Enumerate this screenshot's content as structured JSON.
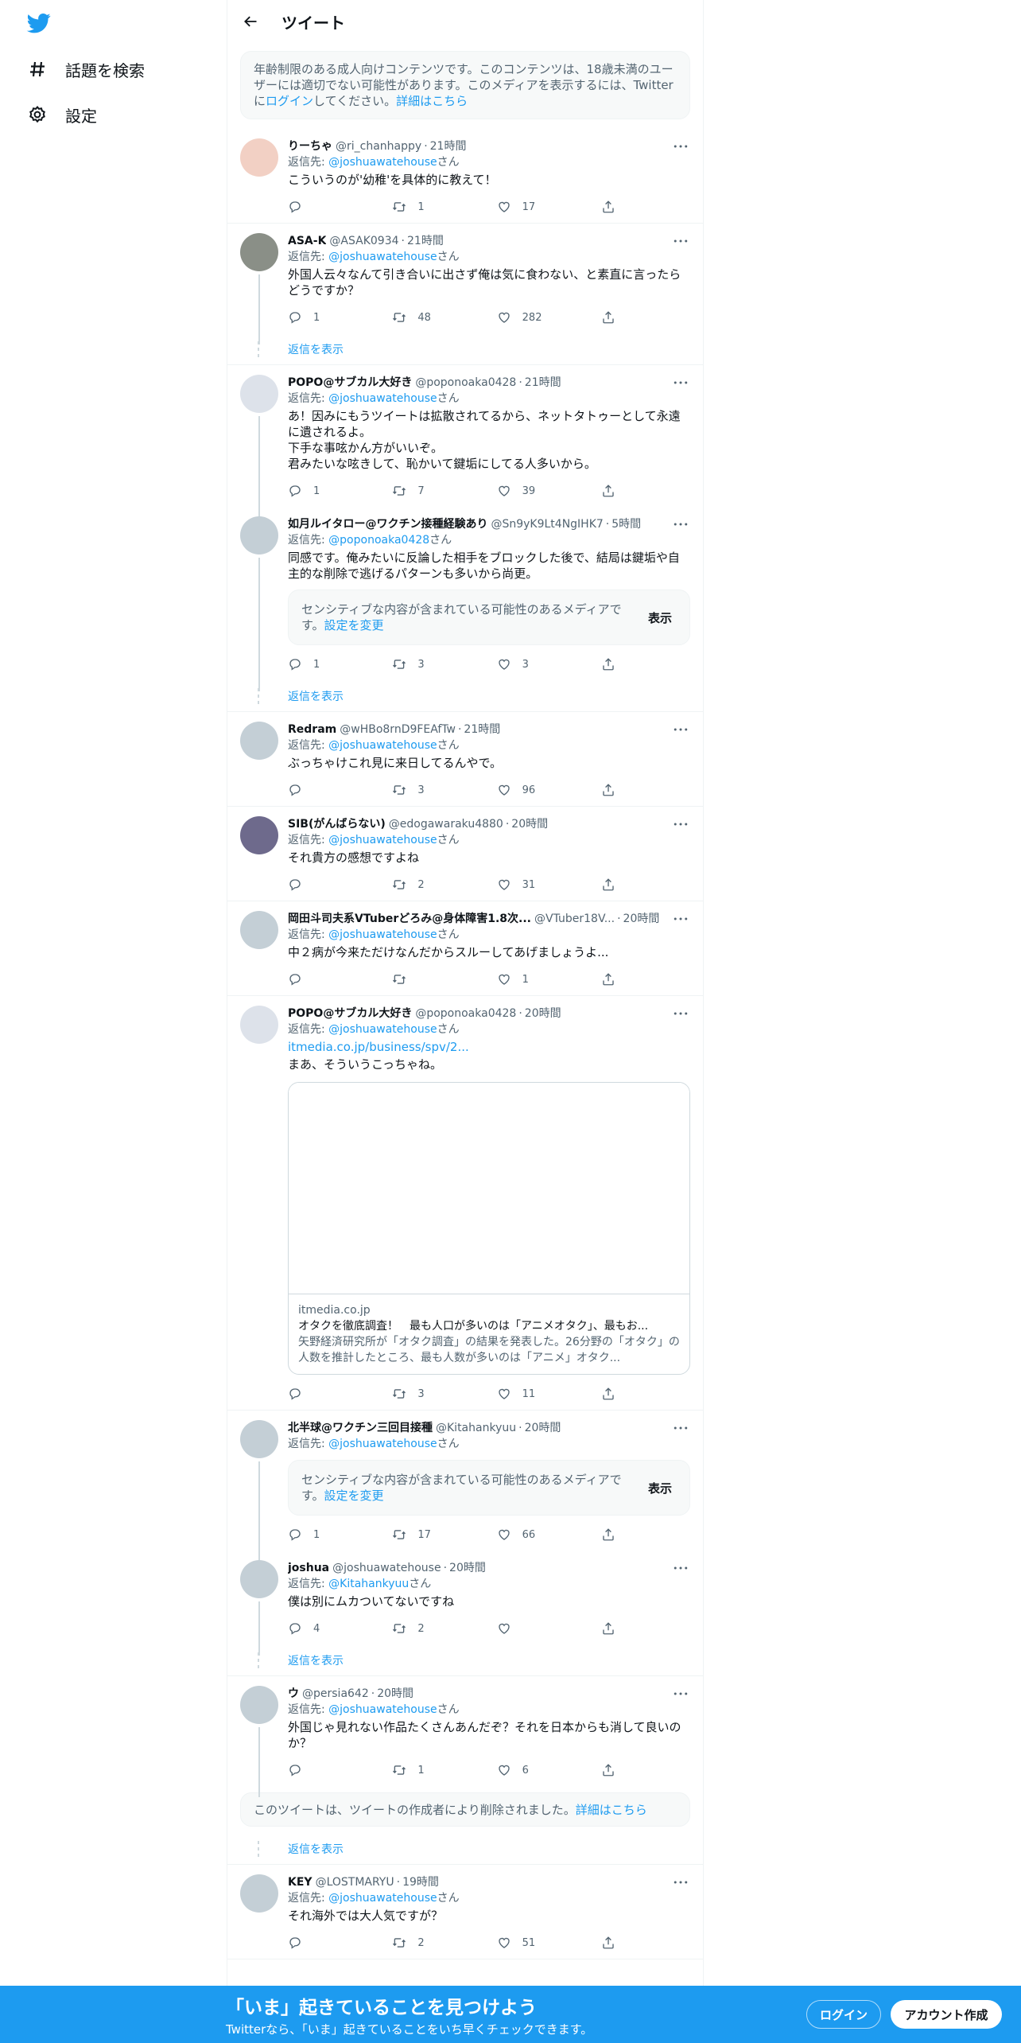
{
  "sidebar": {
    "logo": "twitter-bird-logo",
    "items": [
      {
        "label": "話題を検索",
        "icon": "hashtag-icon"
      },
      {
        "label": "設定",
        "icon": "gear-icon"
      }
    ]
  },
  "header": {
    "title": "ツイート"
  },
  "age_notice": {
    "text_before": "年齢制限のある成人向けコンテンツです。このコンテンツは、18歳未満のユーザーには適切でない可能性があります。このメディアを表示するには、Twitterに",
    "login_link": "ログイン",
    "text_middle": "してください。",
    "details_link": "詳細はこちら"
  },
  "labels": {
    "reply_prefix": "返信先: ",
    "reply_suffix": "さん",
    "show_replies": "返信を表示",
    "sensitive_text": "センシティブな内容が含まれている可能性のあるメディアです。",
    "sensitive_settings": "設定を変更",
    "sensitive_show": "表示",
    "dot": "·"
  },
  "tweets": [
    {
      "name": "りーちゃ",
      "handle": "@ri_chanhappy",
      "time": "21時間",
      "reply_to": "@joshuawatehouse",
      "text": "こういうのが'幼稚'を具体的に教えて！",
      "replies": "",
      "retweets": "1",
      "likes": "17"
    },
    {
      "name": "ASA-K",
      "handle": "@ASAK0934",
      "time": "21時間",
      "reply_to": "@joshuawatehouse",
      "text": "外国人云々なんて引き合いに出さず俺は気に食わない、と素直に言ったらどうですか？",
      "replies": "1",
      "retweets": "48",
      "likes": "282"
    },
    {
      "name": "POPO@サブカル大好き",
      "handle": "@poponoaka0428",
      "time": "21時間",
      "reply_to": "@joshuawatehouse",
      "text": "あ！因みにもうツイートは拡散されてるから、ネットタトゥーとして永遠に遺されるよ。\n下手な事呟かん方がいいぞ。\n君みたいな呟きして、恥かいて鍵垢にしてる人多いから。",
      "replies": "1",
      "retweets": "7",
      "likes": "39"
    },
    {
      "name": "如月ルイタロー@ワクチン接種経験あり",
      "handle": "@Sn9yK9Lt4NgIHK7",
      "time": "5時間",
      "reply_to": "@poponoaka0428",
      "text": "同感です。俺みたいに反論した相手をブロックした後で、結局は鍵垢や自主的な削除で逃げるパターンも多いから尚更。",
      "replies": "1",
      "retweets": "3",
      "likes": "3"
    },
    {
      "name": "Redram",
      "handle": "@wHBo8rnD9FEAfTw",
      "time": "21時間",
      "reply_to": "@joshuawatehouse",
      "text": "ぶっちゃけこれ見に来日してるんやで。",
      "replies": "",
      "retweets": "3",
      "likes": "96"
    },
    {
      "name": "SIB(がんばらない)",
      "handle": "@edogawaraku4880",
      "time": "20時間",
      "reply_to": "@joshuawatehouse",
      "text": "それ貴方の感想ですよね",
      "replies": "",
      "retweets": "2",
      "likes": "31"
    },
    {
      "name": "岡田斗司夫系VTuberどろみ@身体障害1.8次...",
      "handle": "@VTuber18V...",
      "time": "20時間",
      "reply_to": "@joshuawatehouse",
      "text": "中２病が今来ただけなんだからスルーしてあげましょうよ...",
      "replies": "",
      "retweets": "",
      "likes": "1"
    },
    {
      "name": "POPO@サブカル大好き",
      "handle": "@poponoaka0428",
      "time": "20時間",
      "reply_to": "@joshuawatehouse",
      "link": "itmedia.co.jp/business/spv/2...",
      "text": "まあ、そういうこっちゃね。",
      "replies": "",
      "retweets": "3",
      "likes": "11",
      "card": {
        "domain": "itmedia.co.jp",
        "title": "オタクを徹底調査！　最も人口が多いのは「アニメオタク」、最もお...",
        "desc": "矢野経済研究所が「オタク調査」の結果を発表した。26分野の「オタク」の人数を推計したところ、最も人数が多いのは「アニメ」オタク..."
      }
    },
    {
      "name": "北半球@ワクチン三回目接種",
      "handle": "@Kitahankyuu",
      "time": "20時間",
      "reply_to": "@joshuawatehouse",
      "text": "",
      "replies": "1",
      "retweets": "17",
      "likes": "66"
    },
    {
      "name": "joshua",
      "handle": "@joshuawatehouse",
      "time": "20時間",
      "reply_to": "@Kitahankyuu",
      "text": "僕は別にムカついてないですね",
      "replies": "4",
      "retweets": "2",
      "likes": ""
    },
    {
      "name": "ウ",
      "handle": "@persia642",
      "time": "20時間",
      "reply_to": "@joshuawatehouse",
      "text": "外国じゃ見れない作品たくさんあんだぞ？それを日本からも消して良いのか？",
      "replies": "",
      "retweets": "1",
      "likes": "6"
    },
    {
      "name": "KEY",
      "handle": "@LOSTMARYU",
      "time": "19時間",
      "reply_to": "@joshuawatehouse",
      "text": "それ海外では大人気ですが？",
      "replies": "",
      "retweets": "2",
      "likes": "51"
    }
  ],
  "deleted_notice": {
    "text": "このツイートは、ツイートの作成者により削除されました。",
    "link": "詳細はこちら"
  },
  "bottom_bar": {
    "title": "「いま」起きていることを見つけよう",
    "subtitle": "Twitterなら、「いま」起きていることをいち早くチェックできます。",
    "login": "ログイン",
    "signup": "アカウント作成"
  },
  "colors": {
    "accent": "#1d9bf0",
    "text": "#0f1419",
    "secondary": "#536471"
  }
}
